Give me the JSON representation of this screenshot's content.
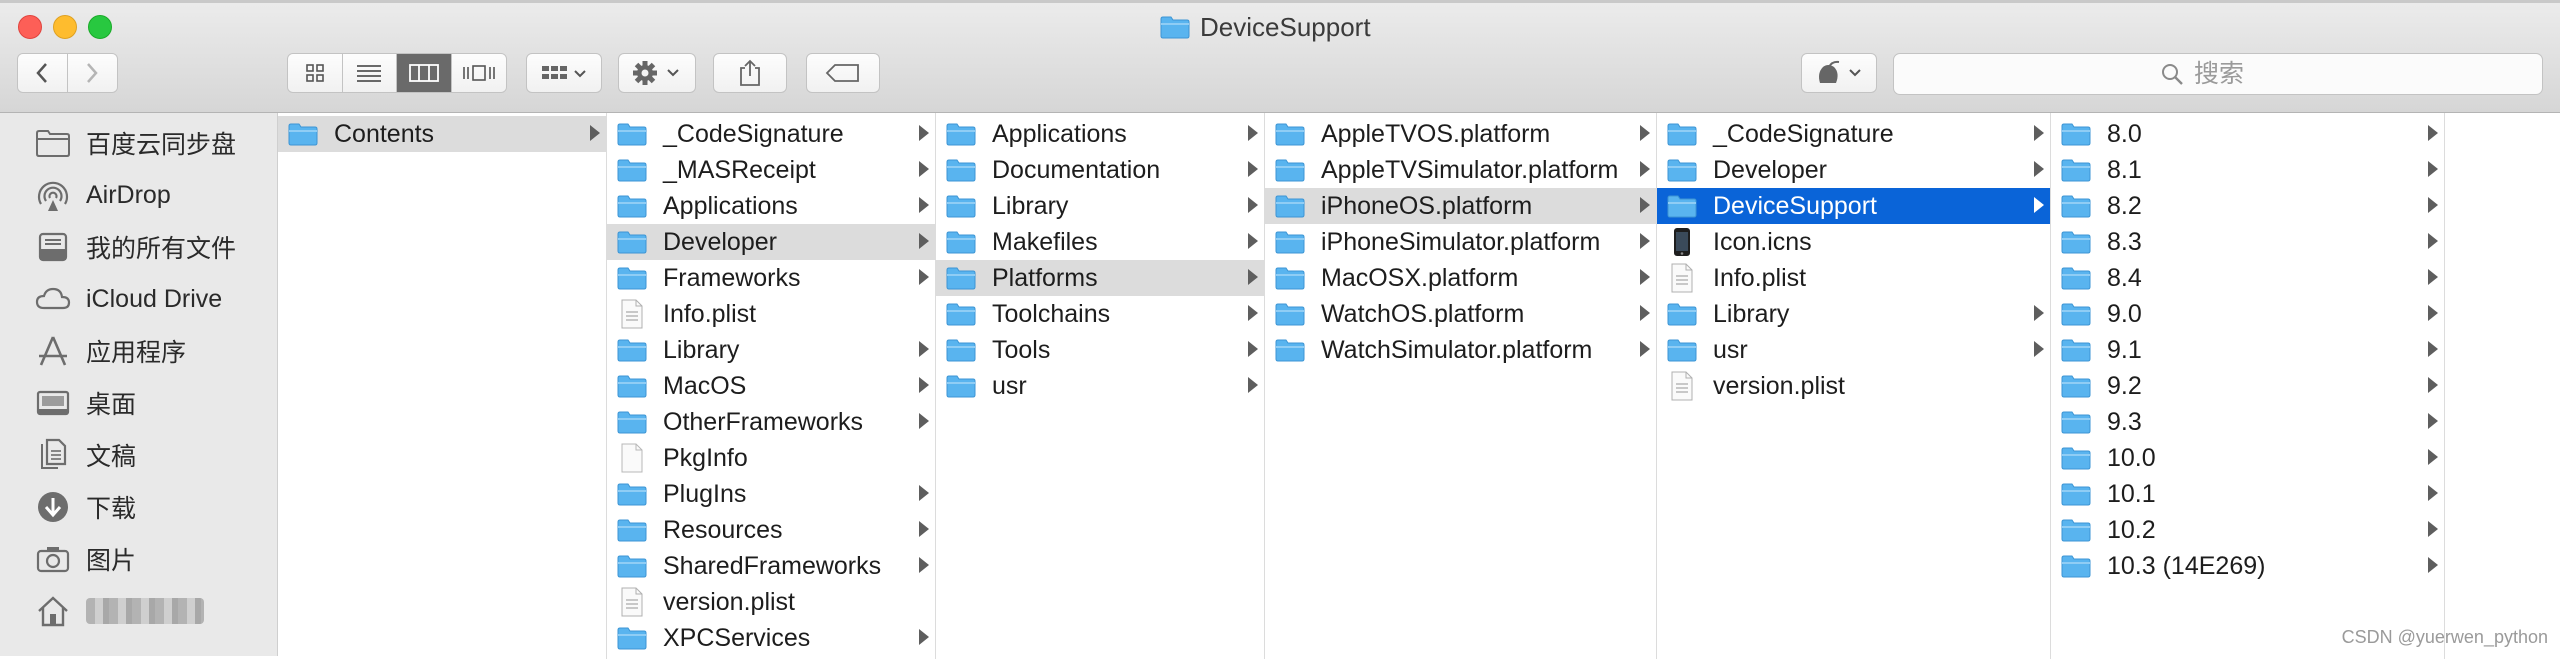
{
  "window": {
    "title": "DeviceSupport"
  },
  "toolbar": {
    "search_placeholder": "搜索",
    "icons": [
      "back-icon",
      "forward-icon",
      "icon-view-icon",
      "list-view-icon",
      "column-view-icon",
      "cover-flow-icon",
      "group-icon",
      "gear-icon",
      "share-icon",
      "tag-icon",
      "app-icon"
    ]
  },
  "colors": {
    "selection_blue": "#0a64d8",
    "folder_blue": "#59b4ef",
    "selection_gray": "#dcdcdc"
  },
  "sidebar": {
    "items": [
      {
        "label": "百度云同步盘",
        "icon": "folder-icon"
      },
      {
        "label": "AirDrop",
        "icon": "airdrop-icon"
      },
      {
        "label": "我的所有文件",
        "icon": "all-files-icon"
      },
      {
        "label": "iCloud Drive",
        "icon": "cloud-icon"
      },
      {
        "label": "应用程序",
        "icon": "applications-icon"
      },
      {
        "label": "桌面",
        "icon": "desktop-icon"
      },
      {
        "label": "文稿",
        "icon": "documents-icon"
      },
      {
        "label": "下载",
        "icon": "downloads-icon"
      },
      {
        "label": "图片",
        "icon": "pictures-icon"
      },
      {
        "label": "",
        "icon": "home-icon"
      }
    ]
  },
  "columns": [
    {
      "items": [
        {
          "name": "Contents",
          "type": "folder",
          "arrow": true,
          "selected": "gray"
        }
      ]
    },
    {
      "items": [
        {
          "name": "_CodeSignature",
          "type": "folder",
          "arrow": true
        },
        {
          "name": "_MASReceipt",
          "type": "folder",
          "arrow": true
        },
        {
          "name": "Applications",
          "type": "folder",
          "arrow": true
        },
        {
          "name": "Developer",
          "type": "folder",
          "arrow": true,
          "selected": "gray"
        },
        {
          "name": "Frameworks",
          "type": "folder",
          "arrow": true
        },
        {
          "name": "Info.plist",
          "type": "plist",
          "arrow": false
        },
        {
          "name": "Library",
          "type": "folder",
          "arrow": true
        },
        {
          "name": "MacOS",
          "type": "folder",
          "arrow": true
        },
        {
          "name": "OtherFrameworks",
          "type": "folder",
          "arrow": true
        },
        {
          "name": "PkgInfo",
          "type": "file",
          "arrow": false
        },
        {
          "name": "PlugIns",
          "type": "folder",
          "arrow": true
        },
        {
          "name": "Resources",
          "type": "folder",
          "arrow": true
        },
        {
          "name": "SharedFrameworks",
          "type": "folder",
          "arrow": true
        },
        {
          "name": "version.plist",
          "type": "plist",
          "arrow": false
        },
        {
          "name": "XPCServices",
          "type": "folder",
          "arrow": true
        }
      ]
    },
    {
      "items": [
        {
          "name": "Applications",
          "type": "folder",
          "arrow": true
        },
        {
          "name": "Documentation",
          "type": "folder",
          "arrow": true
        },
        {
          "name": "Library",
          "type": "folder",
          "arrow": true
        },
        {
          "name": "Makefiles",
          "type": "folder",
          "arrow": true
        },
        {
          "name": "Platforms",
          "type": "folder",
          "arrow": true,
          "selected": "gray"
        },
        {
          "name": "Toolchains",
          "type": "folder",
          "arrow": true
        },
        {
          "name": "Tools",
          "type": "folder",
          "arrow": true
        },
        {
          "name": "usr",
          "type": "folder",
          "arrow": true
        }
      ]
    },
    {
      "items": [
        {
          "name": "AppleTVOS.platform",
          "type": "folder",
          "arrow": true
        },
        {
          "name": "AppleTVSimulator.platform",
          "type": "folder",
          "arrow": true
        },
        {
          "name": "iPhoneOS.platform",
          "type": "folder",
          "arrow": true,
          "selected": "gray"
        },
        {
          "name": "iPhoneSimulator.platform",
          "type": "folder",
          "arrow": true
        },
        {
          "name": "MacOSX.platform",
          "type": "folder",
          "arrow": true
        },
        {
          "name": "WatchOS.platform",
          "type": "folder",
          "arrow": true
        },
        {
          "name": "WatchSimulator.platform",
          "type": "folder",
          "arrow": true
        }
      ]
    },
    {
      "items": [
        {
          "name": "_CodeSignature",
          "type": "folder",
          "arrow": true
        },
        {
          "name": "Developer",
          "type": "folder",
          "arrow": true
        },
        {
          "name": "DeviceSupport",
          "type": "folder",
          "arrow": true,
          "selected": "blue"
        },
        {
          "name": "Icon.icns",
          "type": "phone",
          "arrow": false
        },
        {
          "name": "Info.plist",
          "type": "plist",
          "arrow": false
        },
        {
          "name": "Library",
          "type": "folder",
          "arrow": true
        },
        {
          "name": "usr",
          "type": "folder",
          "arrow": true
        },
        {
          "name": "version.plist",
          "type": "plist",
          "arrow": false
        }
      ]
    },
    {
      "items": [
        {
          "name": "8.0",
          "type": "folder",
          "arrow": true
        },
        {
          "name": "8.1",
          "type": "folder",
          "arrow": true
        },
        {
          "name": "8.2",
          "type": "folder",
          "arrow": true
        },
        {
          "name": "8.3",
          "type": "folder",
          "arrow": true
        },
        {
          "name": "8.4",
          "type": "folder",
          "arrow": true
        },
        {
          "name": "9.0",
          "type": "folder",
          "arrow": true
        },
        {
          "name": "9.1",
          "type": "folder",
          "arrow": true
        },
        {
          "name": "9.2",
          "type": "folder",
          "arrow": true
        },
        {
          "name": "9.3",
          "type": "folder",
          "arrow": true
        },
        {
          "name": "10.0",
          "type": "folder",
          "arrow": true
        },
        {
          "name": "10.1",
          "type": "folder",
          "arrow": true
        },
        {
          "name": "10.2",
          "type": "folder",
          "arrow": true
        },
        {
          "name": "10.3 (14E269)",
          "type": "folder",
          "arrow": true
        }
      ]
    }
  ],
  "watermark": "CSDN @yuerwen_python"
}
